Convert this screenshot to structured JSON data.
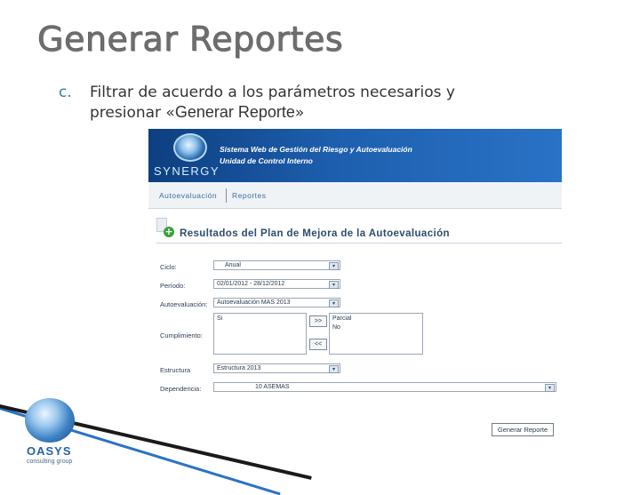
{
  "slide": {
    "title": "Generar Reportes",
    "bullet_marker": "c.",
    "bullet_line1": "Filtrar de acuerdo a los parámetros necesarios y",
    "bullet_line2_prefix": "presionar «",
    "bullet_line2_emph": "Generar Reporte",
    "bullet_line2_suffix": "»"
  },
  "app": {
    "logo_text": "SYNERGY",
    "system_title": "Sistema Web de Gestión del Riesgo y Autoevaluación",
    "system_subtitle": "Unidad de Control Interno",
    "nav": [
      "Autoevaluación",
      "Reportes"
    ],
    "section_title": "Resultados del Plan de Mejora de la Autoevaluación",
    "form": {
      "ciclo_label": "Ciclo:",
      "ciclo_value": "Anual",
      "periodo_label": "Período:",
      "periodo_value": "02/01/2012 - 28/12/2012",
      "autoevaluacion_label": "Autoevaluación:",
      "autoevaluacion_value": "Autoevaluación MAS 2013",
      "cumplimiento_label": "Cumplimiento:",
      "cumplimiento_available": [
        "Si"
      ],
      "cumplimiento_selected": [
        "Parcial",
        "No"
      ],
      "move_right_label": ">>",
      "move_left_label": "<<",
      "estructura_label": "Estructura",
      "estructura_value": "Estructura 2013",
      "dependencia_label": "Dependencia:",
      "dependencia_value": "10 ASEMAS"
    },
    "generate_button": "Generar Reporte"
  },
  "footer": {
    "brand": "OASYS",
    "tagline": "consulting group"
  },
  "colors": {
    "header_blue": "#1d5fae",
    "accent_green": "#3aa03a",
    "title_gray": "#6e6e6e"
  }
}
